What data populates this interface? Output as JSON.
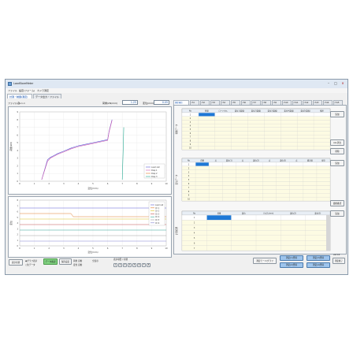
{
  "window": {
    "title": "LoadStoreMeter",
    "menu": [
      "ファイル",
      "設定(フォーム)",
      "カメラ測定"
    ],
    "tabs": [
      "計測・制御(測定)",
      "データ出力・ファイル"
    ]
  },
  "header": {
    "file_label": "ファイル名:",
    "file_value": "S-1-1",
    "field1_label": "荷重(kN/mm)",
    "field1_value": "1.25",
    "field2_label": "変位(mm)",
    "field2_value": "0.05"
  },
  "chart_top": {
    "ylabel": "荷重(kN)",
    "xlabel": "変位(mm)",
    "legend": [
      "Load cell",
      "Disp 1",
      "Disp 2",
      "Disp 3"
    ]
  },
  "chart_bottom": {
    "ylabel": "変位",
    "xlabel": "変位(mm)",
    "legend": [
      "Load cell",
      "Ch 1",
      "Ch 2",
      "Ch 3",
      "Ch 4",
      "Ch 5",
      "Ch 6"
    ]
  },
  "chart_data": [
    {
      "type": "line",
      "xlim": [
        0,
        10
      ],
      "ylim": [
        0,
        9
      ],
      "series": [
        {
          "name": "Load cell",
          "color": "#5a5ad6",
          "x": [
            1.5,
            1.7,
            1.9,
            2.1,
            2.3,
            2.6,
            3.0,
            3.5,
            4.0,
            4.5,
            5.0,
            5.5,
            6.0,
            6.1,
            6.3
          ],
          "y": [
            0.2,
            1.5,
            2.8,
            3.1,
            3.3,
            3.6,
            3.9,
            4.3,
            4.6,
            4.8,
            5.0,
            5.2,
            5.4,
            6.5,
            8.0
          ]
        },
        {
          "name": "Disp 1",
          "color": "#d05ab0",
          "x": [
            1.5,
            1.7,
            1.9,
            2.1,
            2.3,
            2.6,
            3.0,
            3.5,
            4.0,
            4.5,
            5.0,
            5.5,
            6.0,
            6.1,
            6.3
          ],
          "y": [
            0.2,
            1.4,
            2.6,
            3.0,
            3.2,
            3.5,
            3.8,
            4.2,
            4.5,
            4.7,
            4.9,
            5.1,
            5.3,
            6.4,
            7.9
          ]
        },
        {
          "name": "Disp 3",
          "color": "#22a890",
          "x": [
            7.0,
            7.05,
            7.1
          ],
          "y": [
            0.2,
            3.5,
            7.0
          ]
        }
      ]
    }
  ],
  "left_buttons": {
    "b1": "表示切替",
    "r1": "グラフ表示",
    "r2": "生データ",
    "b2": "データ確認",
    "b3": "保存設定",
    "s1": "荷重 自動",
    "s2": "変位 自動",
    "sel": "全表示",
    "box_label": "表示項目 / 切替"
  },
  "pages": [
    "1",
    "2",
    "3",
    "4",
    "5",
    "6",
    "7",
    "8"
  ],
  "right_tabs": [
    "測定項目",
    "ch1",
    "ch2",
    "ch3",
    "ch4",
    "ch5",
    "ch6",
    "ch7",
    "ch8",
    "ch9",
    "ch10",
    "ch11",
    "ch12",
    "ch13",
    "ch14",
    "ch15"
  ],
  "grid1": {
    "side": "荷重データ",
    "headers": [
      "No",
      "時間",
      "ロードセル",
      "変位1(変換)",
      "変位2(変換)",
      "変位3(変換)",
      "変位4(変換)",
      "変位5(変換)",
      "備考"
    ],
    "rows": [
      "1",
      "2",
      "3",
      "4",
      "5",
      "6",
      "7",
      "8",
      "9",
      "10"
    ]
  },
  "grid2": {
    "side": "変位データ",
    "headers": [
      "No",
      "荷重",
      "点",
      "変位(1)",
      "点",
      "変位(2)",
      "点",
      "変位(3)",
      "点",
      "補正値",
      "保存"
    ],
    "rows": [
      "1",
      "2",
      "3",
      "4",
      "5",
      "6",
      "7",
      "8",
      "9",
      "10"
    ]
  },
  "grid3": {
    "side": "計測結果",
    "headers": [
      "No",
      "荷重",
      "変位",
      "ひずみ(mm)",
      "変位(2)",
      "変位(3)"
    ],
    "rows": [
      "1",
      "2",
      "3",
      "4",
      "5",
      "6",
      "7"
    ]
  },
  "right_buttons": {
    "b1": "追加",
    "b2": "ALL消去",
    "b3": "削除",
    "b4": "追加",
    "b5": "追加",
    "b6": "最終確認",
    "b7": "追加"
  },
  "bottom_right": {
    "mode": "測定モード/グラフ",
    "r1": "測定(1)登録",
    "r2": "測定(2)登録",
    "r3": "測定(3)登録",
    "r4": "測定(4)登録",
    "end": "測定終了",
    "ver": "ver1.0"
  }
}
